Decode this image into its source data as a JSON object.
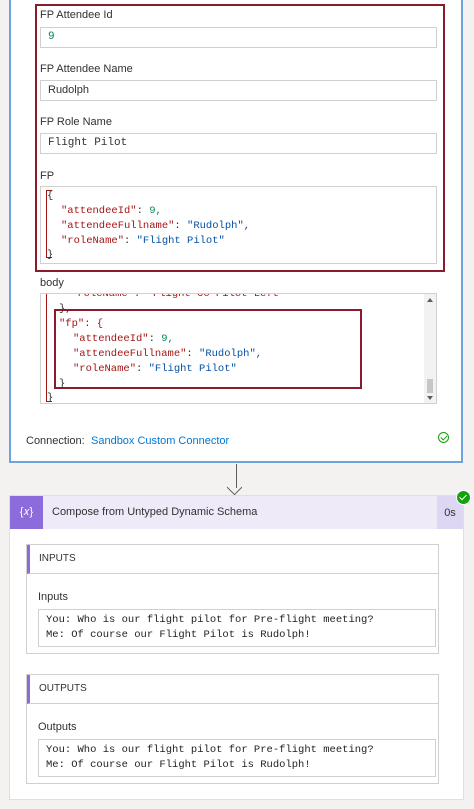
{
  "action_card": {
    "fields": [
      {
        "label": "FP Attendee Id",
        "value": "9"
      },
      {
        "label": "FP Attendee Name",
        "value": "Rudolph"
      },
      {
        "label": "FP Role Name",
        "value": "Flight Pilot"
      }
    ],
    "fp": {
      "label": "FP",
      "open_brace": "{",
      "close_brace": "}",
      "lines": [
        {
          "key": "\"attendeeId\"",
          "value": "9,",
          "value_kind": "num"
        },
        {
          "key": "\"attendeeFullname\"",
          "value": "\"Rudolph\",",
          "value_kind": "str"
        },
        {
          "key": "\"roleName\"",
          "value": "\"Flight Pilot\"",
          "value_kind": "str"
        }
      ]
    },
    "body": {
      "label": "body",
      "partial_top_line": "\"roleName\": \"Flight Co-Pilot Left\"",
      "close_prev": "},",
      "fp_key": "\"fp\": {",
      "lines": [
        {
          "key": "\"attendeeId\"",
          "value": "9,",
          "value_kind": "num"
        },
        {
          "key": "\"attendeeFullname\"",
          "value": "\"Rudolph\",",
          "value_kind": "str"
        },
        {
          "key": "\"roleName\"",
          "value": "\"Flight Pilot\"",
          "value_kind": "str"
        }
      ],
      "close_fp": "}",
      "close_root": "}"
    },
    "connection_label": "Connection:",
    "connection_name": "Sandbox Custom Connector"
  },
  "compose_card": {
    "title": "Compose from Untyped Dynamic Schema",
    "icon": "{𝑥}",
    "duration": "0s",
    "inputs": {
      "header": "INPUTS",
      "label": "Inputs",
      "text": "You: Who is our flight pilot for Pre-flight meeting?\nMe: Of course our Flight Pilot is Rudolph!"
    },
    "outputs": {
      "header": "OUTPUTS",
      "label": "Outputs",
      "text": "You: Who is our flight pilot for Pre-flight meeting?\nMe: Of course our Flight Pilot is Rudolph!"
    }
  },
  "colors": {
    "accent_border": "#6ea4de",
    "highlight_red": "#8b1a2b",
    "compose_purple": "#8c6cdb",
    "success_green": "#13a10e"
  }
}
